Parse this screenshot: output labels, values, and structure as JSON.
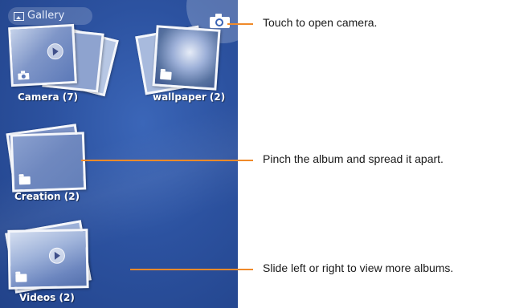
{
  "topbar": {
    "title": "Gallery",
    "icon": "gallery-icon"
  },
  "camera_button": {
    "icon": "camera-icon"
  },
  "albums": [
    {
      "name": "Camera (7)",
      "overlay_icon": "camera-icon",
      "has_play": true
    },
    {
      "name": "wallpaper (2)",
      "overlay_icon": "folder-icon",
      "has_play": false
    },
    {
      "name": "Creation (2)",
      "overlay_icon": "folder-icon",
      "has_play": false
    },
    {
      "name": "Videos (2)",
      "overlay_icon": "folder-icon",
      "has_play": true
    }
  ],
  "callouts": [
    {
      "text": "Touch to open camera."
    },
    {
      "text": "Pinch the album and spread it apart."
    },
    {
      "text": "Slide left or right to view more albums."
    }
  ],
  "colors": {
    "screen_bg": "#2c52a0",
    "callout_line": "#f08a2a",
    "label": "#ffffff"
  }
}
